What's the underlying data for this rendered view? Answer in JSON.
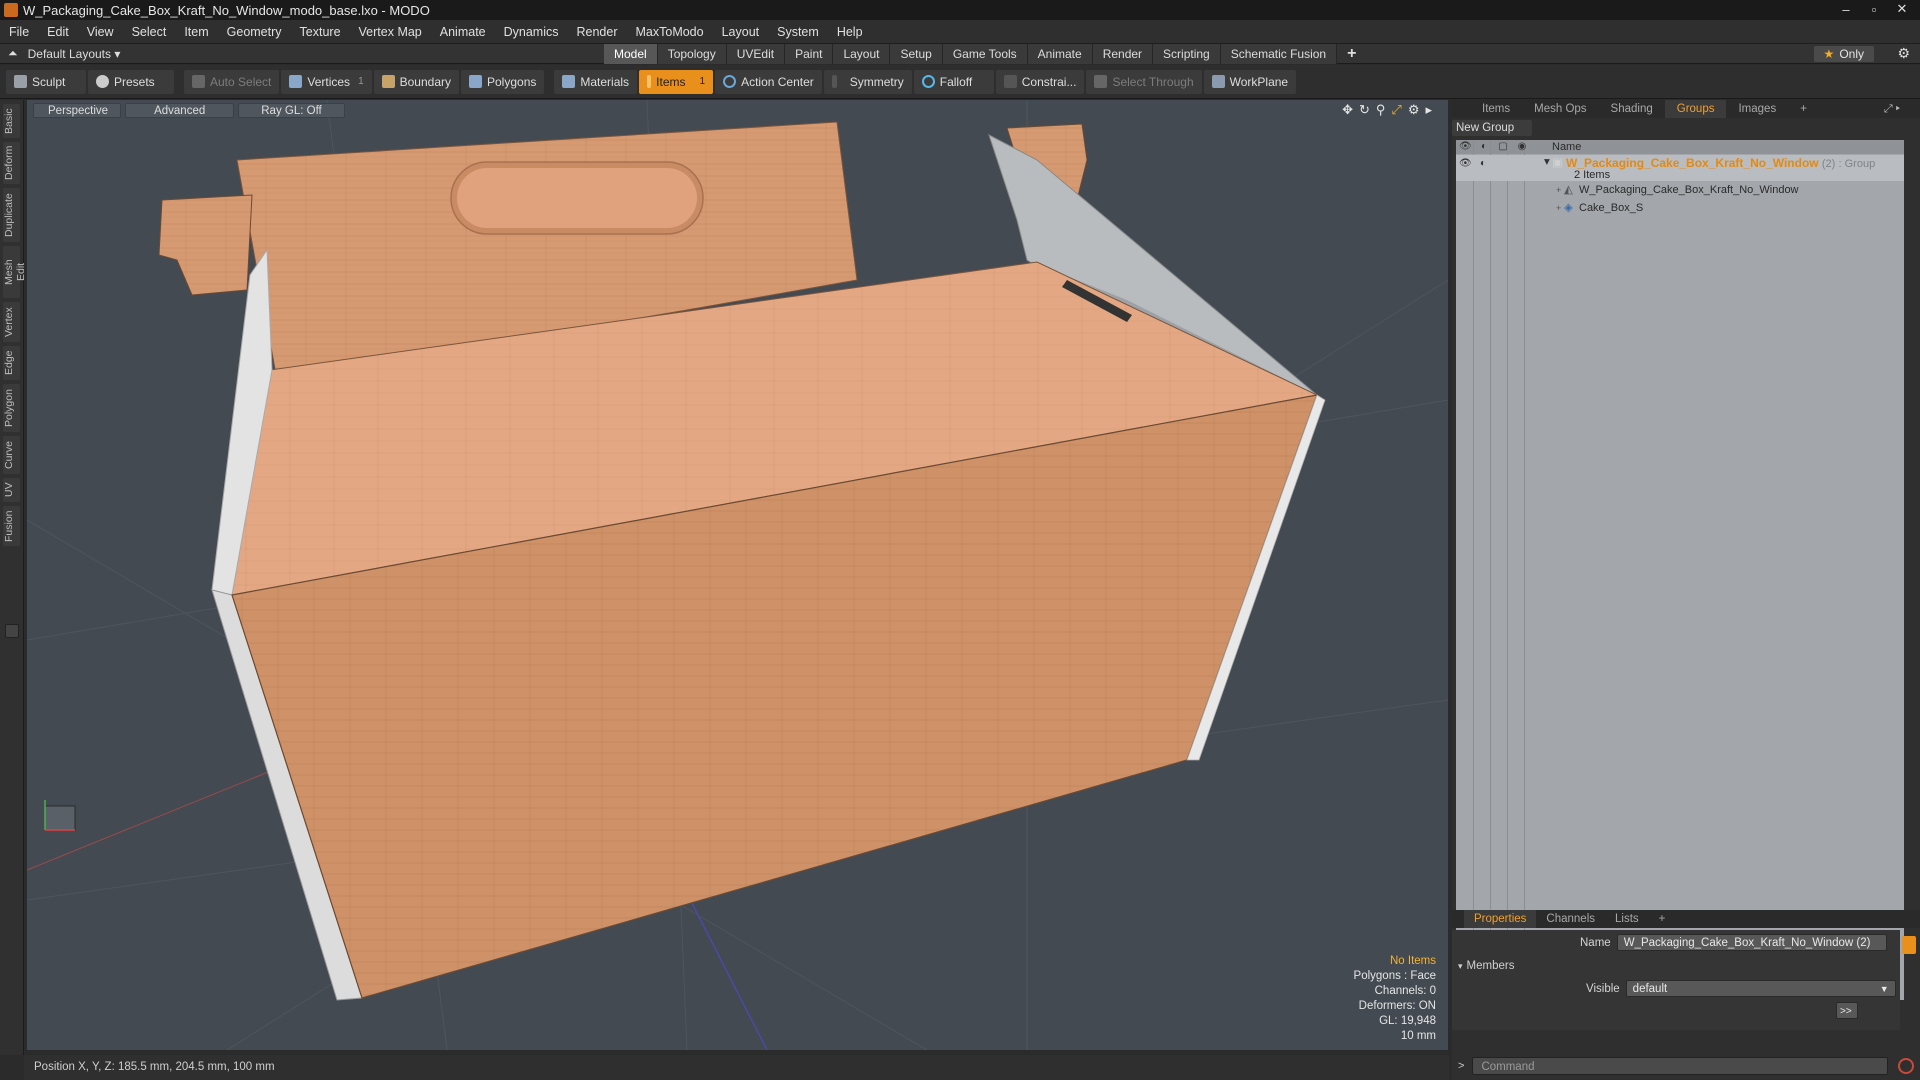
{
  "titlebar": {
    "title": "W_Packaging_Cake_Box_Kraft_No_Window_modo_base.lxo - MODO",
    "minimize": "‒",
    "maximize": "▫",
    "close": "✕"
  },
  "menu": [
    "File",
    "Edit",
    "View",
    "Select",
    "Item",
    "Geometry",
    "Texture",
    "Vertex Map",
    "Animate",
    "Dynamics",
    "Render",
    "MaxToModo",
    "Layout",
    "System",
    "Help"
  ],
  "layoutbar": {
    "layouts_label": "Default Layouts ▾",
    "tabs": [
      "Model",
      "Topology",
      "UVEdit",
      "Paint",
      "Layout",
      "Setup",
      "Game Tools",
      "Animate",
      "Render",
      "Scripting",
      "Schematic Fusion"
    ],
    "active_tab": "Model",
    "add": "+",
    "only_label": "Only",
    "gear": "⚙"
  },
  "toolbar": {
    "sculpt": "Sculpt",
    "presets": "Presets",
    "auto_select": "Auto Select",
    "vertices": "Vertices",
    "vertices_count": "1",
    "boundary": "Boundary",
    "polygons": "Polygons",
    "materials": "Materials",
    "items": "Items",
    "items_count": "1",
    "action_center": "Action Center",
    "symmetry": "Symmetry",
    "falloff": "Falloff",
    "constraints": "Constrai...",
    "select_through": "Select Through",
    "workplane": "WorkPlane"
  },
  "left_tabs": [
    "Basic",
    "Deform",
    "Duplicate",
    "Mesh Edit",
    "Vertex",
    "Edge",
    "Polygon",
    "Curve",
    "UV",
    "Fusion"
  ],
  "viewport": {
    "view": "Perspective",
    "shading": "Advanced",
    "raygl": "Ray GL: Off",
    "icons": [
      "move-icon",
      "rotate-icon",
      "zoom-icon",
      "fit-icon",
      "settings-icon",
      "expand-icon"
    ],
    "stats": {
      "items": "No Items",
      "polygons": "Polygons : Face",
      "channels": "Channels: 0",
      "deformers": "Deformers: ON",
      "gl": "GL: 19,948",
      "scale": "10 mm"
    }
  },
  "statusbar": {
    "position": "Position X, Y, Z:  185.5 mm, 204.5 mm, 100 mm"
  },
  "right_panel": {
    "tabs": [
      "Items",
      "Mesh Ops",
      "Shading",
      "Groups",
      "Images"
    ],
    "active_tab": "Groups",
    "add": "+",
    "new_group": "New Group",
    "column_name": "Name",
    "group": {
      "name": "W_Packaging_Cake_Box_Kraft_No_Window",
      "count": "(2)",
      "type": ": Group",
      "items_label": "2 Items",
      "children": [
        "W_Packaging_Cake_Box_Kraft_No_Window",
        "Cake_Box_S"
      ]
    }
  },
  "properties": {
    "tabs": [
      "Properties",
      "Channels",
      "Lists"
    ],
    "active_tab": "Properties",
    "add": "+",
    "name_label": "Name",
    "name_value": "W_Packaging_Cake_Box_Kraft_No_Window (2)",
    "members_label": "Members",
    "visible_label": "Visible",
    "visible_value": "default",
    "more": ">>"
  },
  "command": {
    "prompt": ">",
    "placeholder": "Command"
  },
  "colors": {
    "accent": "#e9901c",
    "viewport_bg": "#434a52",
    "kraft": "#d79a73",
    "group_name": "#e38a12"
  }
}
